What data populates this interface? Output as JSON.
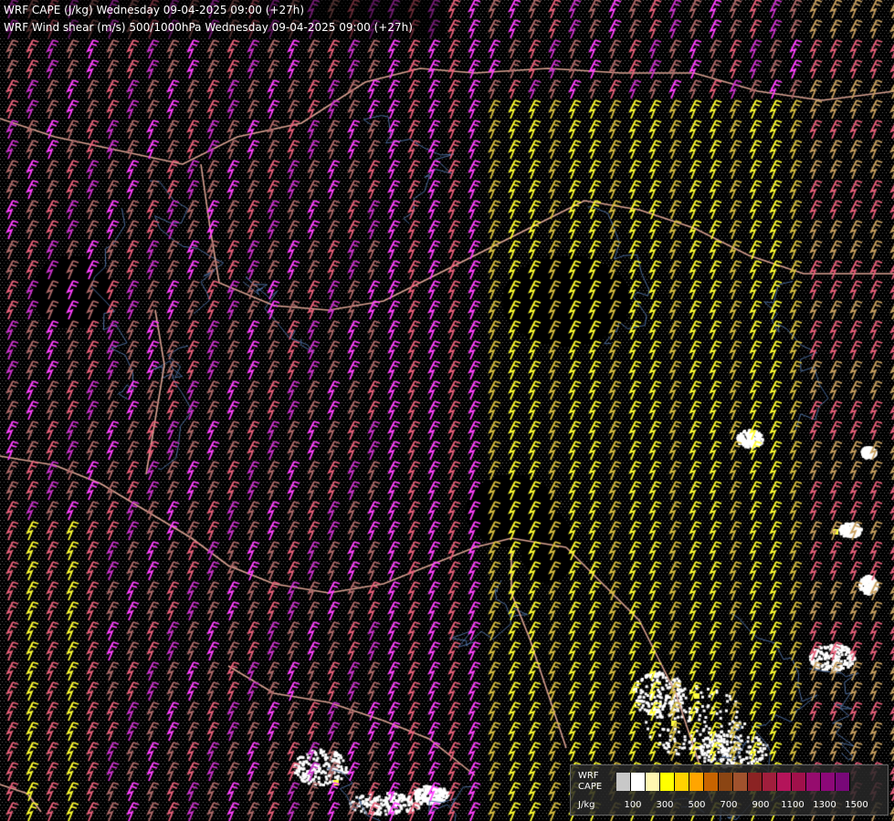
{
  "header": {
    "line1": "WRF CAPE (J/kg) Wednesday 09-04-2025 09:00 (+27h)",
    "line2": "WRF Wind shear (m/s) 500/1000hPa Wednesday 09-04-2025 09:00 (+27h)"
  },
  "legend": {
    "name_line1": "WRF",
    "name_line2": "CAPE",
    "unit": "J/kg",
    "colors": [
      "#c8c8c8",
      "#ffffff",
      "#fff7b0",
      "#ffff00",
      "#ffd200",
      "#ffa500",
      "#c86400",
      "#8b4513",
      "#a0522d",
      "#8b2323",
      "#a01e3c",
      "#b4145a",
      "#a0104a",
      "#960c6e",
      "#8c0878",
      "#780878"
    ],
    "tick_labels": [
      "100",
      "300",
      "500",
      "700",
      "900",
      "1100",
      "1300",
      "1500"
    ]
  },
  "map_layers": {
    "barb_colors": [
      "#ff40ff",
      "#cc33cc",
      "#e8607a",
      "#b06a6a",
      "#ffff30",
      "#d8c040",
      "#c8a060"
    ],
    "border_color": "#d8a090",
    "river_color": "#4a6a9a",
    "cape_blob_color": "#ffffff"
  }
}
